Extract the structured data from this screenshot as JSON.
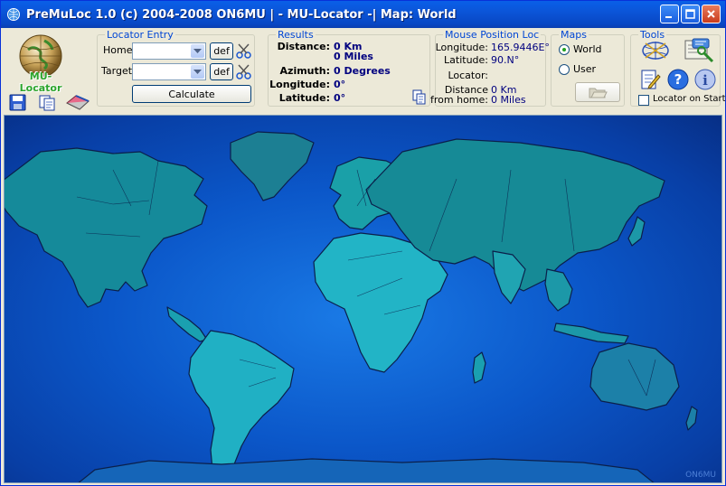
{
  "window": {
    "title": "PreMuLoc 1.0 (c) 2004-2008 ON6MU  | - MU-Locator -|  Map: World",
    "logo_text": "MU-Locator"
  },
  "locator_entry": {
    "title": "Locator Entry",
    "home_label": "Home:",
    "home_value": "",
    "target_label": "Target:",
    "target_value": "",
    "def_label": "def",
    "calculate_label": "Calculate"
  },
  "results": {
    "title": "Results",
    "distance_label": "Distance:",
    "distance_km": "0 Km",
    "distance_miles": "0 Miles",
    "azimuth_label": "Azimuth:",
    "azimuth_value": "0 Degrees",
    "longitude_label": "Longitude:",
    "longitude_value": "0°",
    "latitude_label": "Latitude:",
    "latitude_value": "0°"
  },
  "mouse_position": {
    "title": "Mouse Position Loc",
    "longitude_label": "Longitude:",
    "longitude_value": "165.9446E°",
    "latitude_label": "Latitude:",
    "latitude_value": "90.N°",
    "locator_label": "Locator:",
    "locator_value": "",
    "distance_label_1": "Distance",
    "distance_label_2": "from home:",
    "distance_km": "0 Km",
    "distance_miles": "0 Miles"
  },
  "maps": {
    "title": "Maps",
    "world_label": "World",
    "user_label": "User",
    "selected": "World"
  },
  "tools": {
    "title": "Tools",
    "locator_on_start_label": "Locator on Start",
    "locator_on_start_checked": false
  },
  "map": {
    "credit": "ON6MU"
  },
  "colors": {
    "title_bar": "#0b55d8",
    "group_title": "#0046d5",
    "value_text": "#00007f",
    "ocean": "#0b57c9",
    "land": "#1ea5b5"
  }
}
